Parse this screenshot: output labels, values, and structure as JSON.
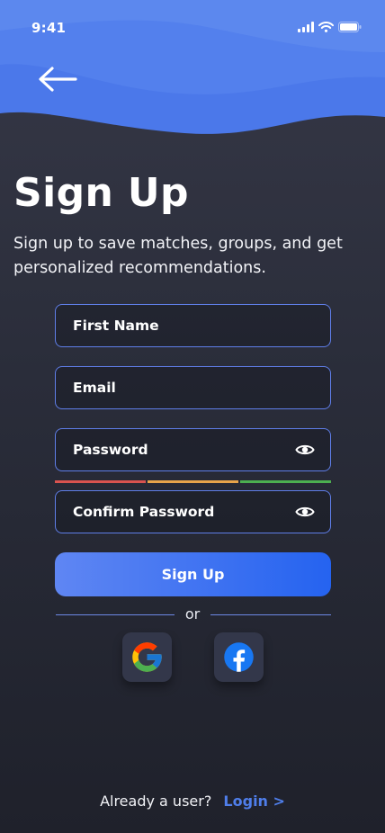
{
  "status_bar": {
    "time": "9:41"
  },
  "header": {
    "title": "Sign Up",
    "subtitle": "Sign up to save matches, groups, and get personalized recommendations."
  },
  "form": {
    "first_name_placeholder": "First Name",
    "email_placeholder": "Email",
    "password_placeholder": "Password",
    "confirm_password_placeholder": "Confirm Password",
    "password_strength_colors": [
      "#d9534f",
      "#e8a44a",
      "#4caf50"
    ],
    "submit_label": "Sign Up"
  },
  "divider": {
    "text": "or"
  },
  "social": [
    {
      "name": "Google",
      "icon": "google-icon"
    },
    {
      "name": "Facebook",
      "icon": "facebook-icon"
    }
  ],
  "footer": {
    "question": "Already a user?",
    "link_label": "Login >"
  },
  "colors": {
    "accent": "#4f7eea",
    "wave": "#4f7eea",
    "background": "#2c2f3c"
  }
}
